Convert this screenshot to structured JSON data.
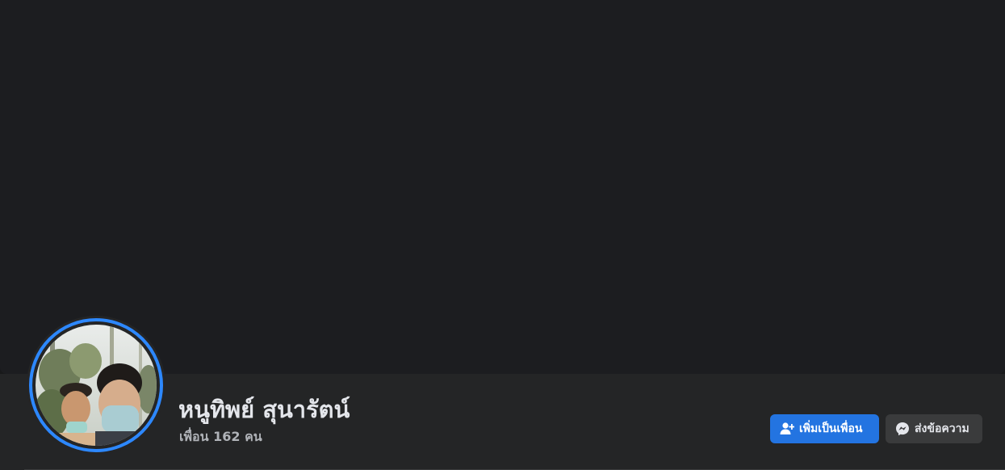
{
  "profile": {
    "name": "หนูทิพย์ สุนารัตน์",
    "friends_text": "เพื่อน 162 คน"
  },
  "actions": {
    "add_friend_label": "เพิ่มเป็นเพื่อน",
    "message_label": "ส่งข้อความ"
  },
  "icons": {
    "add_friend": "add-friend-icon",
    "messenger": "messenger-icon"
  },
  "colors": {
    "accent": "#2374e1",
    "ring": "#2d88ff",
    "background": "#18191a",
    "surface": "#242526"
  }
}
